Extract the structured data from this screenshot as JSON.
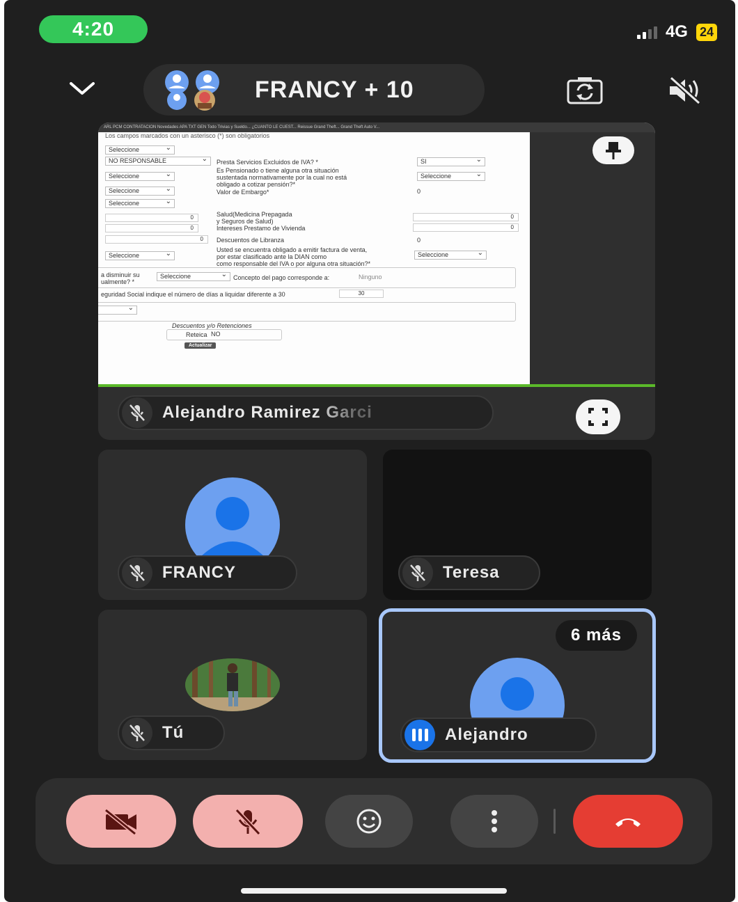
{
  "status_bar": {
    "time": "4:20",
    "network": "4G",
    "battery": "24"
  },
  "header": {
    "title": "FRANCY + 10"
  },
  "presentation": {
    "presenter_name": "Alejandro Ramirez Garci",
    "browser_tabs": "ARL PCM   CONTRATACION   Novedades   APA   TXT GEN   Todo Trivias y Sueldo...   ¿CUANTO LE CUEST...   Reissue Grand Theft...   Grand Theft Auto V...",
    "form": {
      "header_text": "Los campos marcados con un asterisco (*) son obligatorios",
      "left_selects": [
        "Seleccione",
        "NO RESPONSABLE",
        "Seleccione",
        "Seleccione",
        "Seleccione",
        "Seleccione"
      ],
      "left_numbers": [
        "0",
        "0",
        "0"
      ],
      "labels": [
        "Presta Servicios Excluidos de IVA? *",
        "Es Pensionado o tiene alguna otra situación",
        "sustentada normativamente por la cual no está",
        "obligado a cotizar pensión?*",
        "Valor de Embargo*",
        "Salud(Medicina Prepagada",
        "y Seguros de Salud)",
        "Intereses Prestamo de Vivienda",
        "Descuentos de Libranza",
        "Usted se encuentra obligado a emitir factura de venta,",
        "por estar clasificado ante la DIAN como",
        "como responsable del IVA o por alguna otra situación?*"
      ],
      "right_values": [
        "SI",
        "Seleccione",
        "0",
        "0",
        "0",
        "0",
        "Seleccione"
      ],
      "disminuir_1": "a disminuir su",
      "disminuir_2": "ualmente? *",
      "disminuir_select": "Seleccione",
      "concepto_label": "Concepto del pago corresponde a:",
      "concepto_value": "Ninguno",
      "seguridad_label": "eguridad Social indique el número de días a liquidar diferente a 30",
      "dias_value": "30",
      "descuentos_title": "Descuentos y/o Retenciones",
      "reteica_label": "Reteica",
      "reteica_value": "NO",
      "update_button": "Actualizar"
    }
  },
  "participants": [
    {
      "name": "FRANCY"
    },
    {
      "name": "Teresa"
    },
    {
      "name": "Tú"
    },
    {
      "name": "Alejandro",
      "more_label": "6 más"
    }
  ],
  "colors": {
    "background": "#1f1f1f",
    "tile": "#2d2d2d",
    "active_border": "#a8c7fa",
    "avatar_blue": "#6da0f0",
    "muted_control": "#f3b0ae",
    "end_call": "#e53d33",
    "clock_pill": "#34c759"
  },
  "icons": [
    "chevron-down-icon",
    "group-avatar-icon",
    "switch-camera-icon",
    "speaker-off-icon",
    "pin-icon",
    "fullscreen-icon",
    "mic-off-icon",
    "audio-active-icon",
    "camera-off-icon",
    "emoji-icon",
    "more-vert-icon",
    "end-call-icon"
  ]
}
